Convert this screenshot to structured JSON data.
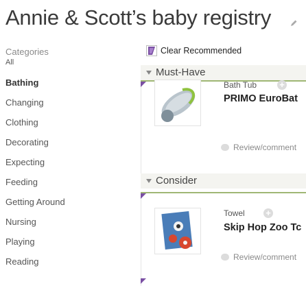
{
  "page": {
    "title": "Annie & Scott’s baby registry",
    "edit_icon": "pencil-icon"
  },
  "categories": {
    "heading": "Categories",
    "items": [
      {
        "label": "All",
        "style": "small"
      },
      {
        "label": "Bathing",
        "style": "active"
      },
      {
        "label": "Changing"
      },
      {
        "label": "Clothing"
      },
      {
        "label": "Decorating"
      },
      {
        "label": "Expecting"
      },
      {
        "label": "Feeding"
      },
      {
        "label": "Getting Around"
      },
      {
        "label": "Nursing"
      },
      {
        "label": "Playing"
      },
      {
        "label": "Reading"
      }
    ]
  },
  "toolbar": {
    "clear_recommended": "Clear Recommended",
    "flag_icon": "purple-flag-icon"
  },
  "sections": [
    {
      "title": "Must-Have",
      "items": [
        {
          "category": "Bath Tub",
          "name": "PRIMO EuroBat",
          "review": "Review/comment"
        }
      ]
    },
    {
      "title": "Consider",
      "items": [
        {
          "category": "Towel",
          "name": "Skip Hop Zoo Tc",
          "review": "Review/comment"
        }
      ]
    }
  ],
  "colors": {
    "accent_green": "#9fb774",
    "flag_purple": "#7a4fa3"
  }
}
